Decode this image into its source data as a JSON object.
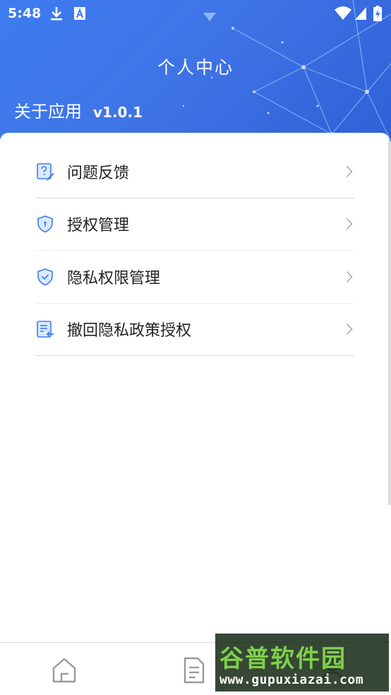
{
  "status_bar": {
    "time": "5:48",
    "icons": [
      "download-icon",
      "a-notification-icon",
      "wifi-icon",
      "signal-icon",
      "battery-icon"
    ]
  },
  "header": {
    "title": "个人中心",
    "about_label": "关于应用",
    "version": "v1.0.1",
    "accent_color": "#3d7cf0"
  },
  "menu": {
    "items": [
      {
        "label": "问题反馈",
        "icon": "feedback-icon"
      },
      {
        "label": "授权管理",
        "icon": "shield-icon"
      },
      {
        "label": "隐私权限管理",
        "icon": "shield-check-icon"
      },
      {
        "label": "撤回隐私政策授权",
        "icon": "revoke-document-icon"
      }
    ]
  },
  "bottom_nav": {
    "items": [
      {
        "icon": "home-icon"
      },
      {
        "icon": "document-icon"
      },
      {
        "icon": "user-icon"
      }
    ]
  },
  "watermark": {
    "title": "谷普软件园",
    "url": "www.gupuxiazai.com"
  }
}
